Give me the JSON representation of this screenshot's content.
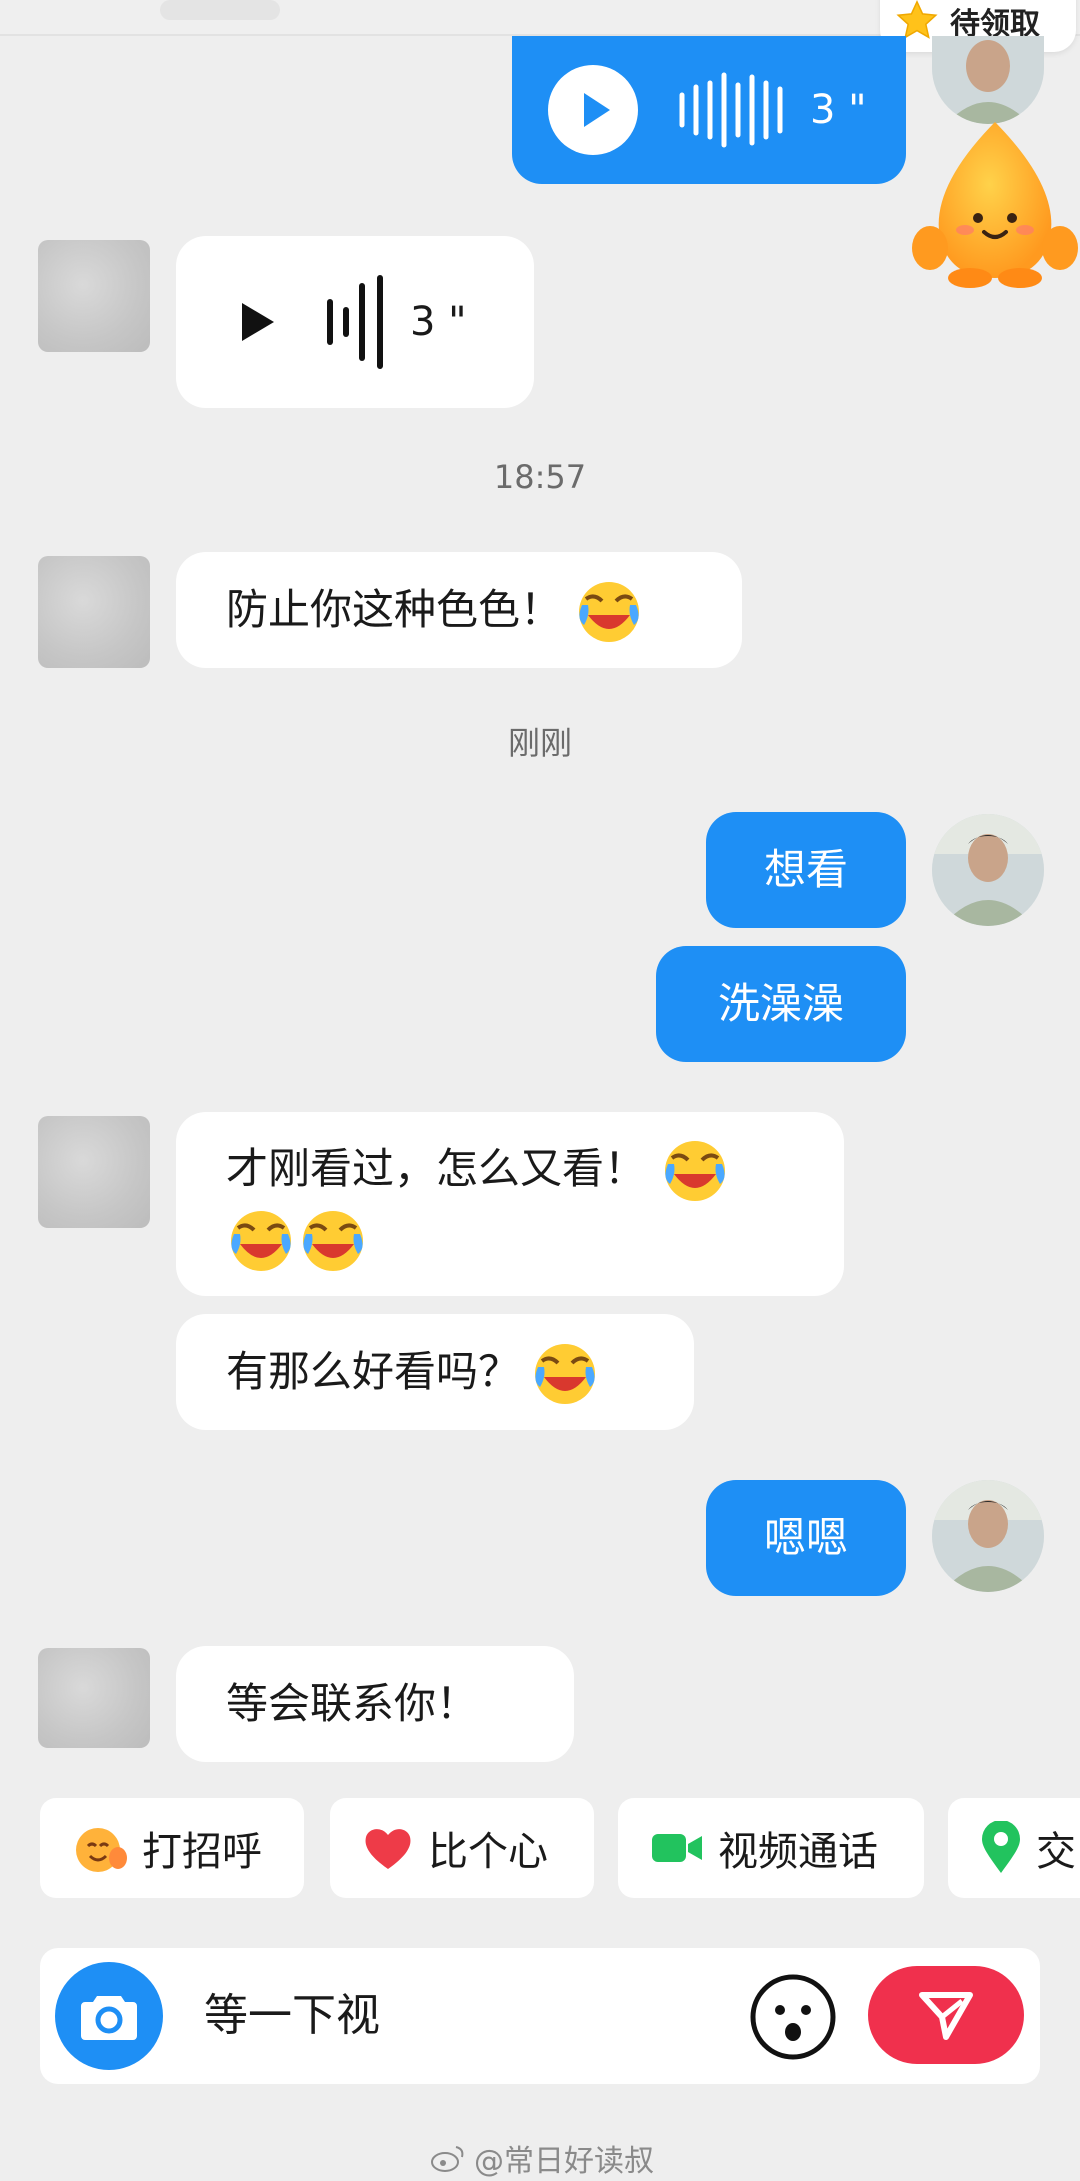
{
  "badge": {
    "label": "待领取"
  },
  "messages": {
    "voice_out": {
      "duration": "3 \""
    },
    "voice_in": {
      "duration": "3 \""
    },
    "time_1": "18:57",
    "in_1": "防止你这种色色！",
    "time_2": "刚刚",
    "out_1": "想看",
    "out_2": "洗澡澡",
    "in_2": "才刚看过，怎么又看！",
    "in_3": "有那么好看吗？",
    "out_3": "嗯嗯",
    "in_4": "等会联系你！"
  },
  "quick_actions": [
    {
      "label": "打招呼",
      "icon": "wave-face-icon"
    },
    {
      "label": "比个心",
      "icon": "heart-icon"
    },
    {
      "label": "视频通话",
      "icon": "video-camera-icon"
    },
    {
      "label": "交",
      "icon": "location-pin-icon"
    }
  ],
  "composer": {
    "text": "等一下视"
  },
  "watermark": "@常日好读叔",
  "colors": {
    "accent": "#1e8ff5",
    "send": "#f0304d",
    "background": "#eeeeee"
  }
}
